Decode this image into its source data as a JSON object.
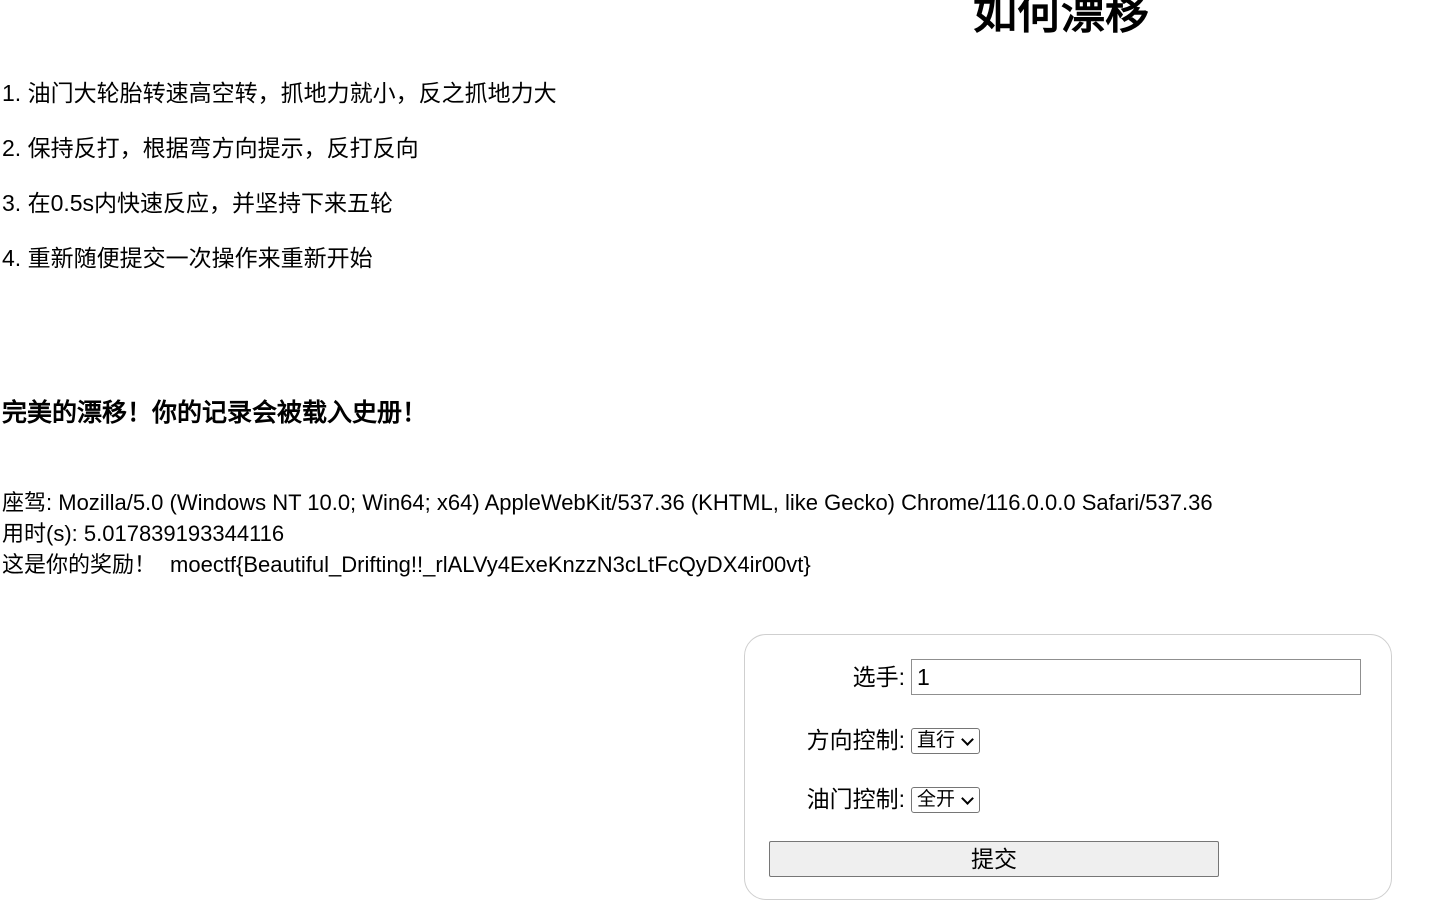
{
  "page": {
    "title": "如何漂移"
  },
  "instructions": [
    "1. 油门大轮胎转速高空转，抓地力就小，反之抓地力大",
    "2. 保持反打，根据弯方向提示，反打反向",
    "3. 在0.5s内快速反应，并坚持下来五轮",
    "4. 重新随便提交一次操作来重新开始"
  ],
  "result": {
    "heading": "完美的漂移！你的记录会被载入史册！",
    "driver_label": "座驾:",
    "driver_value": "Mozilla/5.0 (Windows NT 10.0; Win64; x64) AppleWebKit/537.36 (KHTML, like Gecko) Chrome/116.0.0.0 Safari/537.36",
    "time_label": "用时(s):",
    "time_value": "5.017839193344116",
    "reward_label": "这是你的奖励！",
    "flag": "moectf{Beautiful_Drifting!!_rlALVy4ExeKnzzN3cLtFcQyDX4ir00vt}"
  },
  "form": {
    "player_label": "选手:",
    "player_value": "1",
    "direction_label": "方向控制:",
    "direction_selected": "直行",
    "throttle_label": "油门控制:",
    "throttle_selected": "全开",
    "submit_label": "提交"
  }
}
